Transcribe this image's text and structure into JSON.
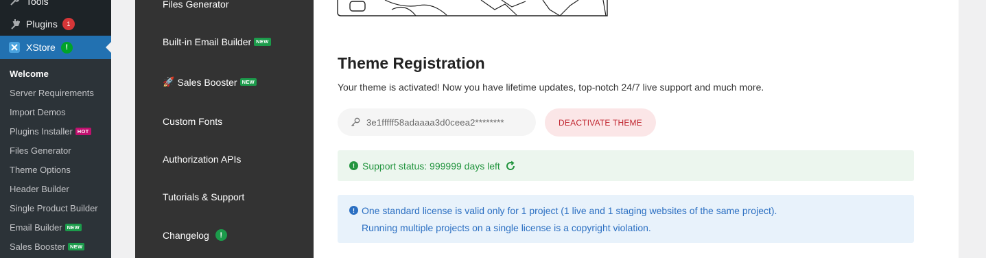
{
  "wp_menu": {
    "tools_label": "Tools",
    "plugins_label": "Plugins",
    "plugins_count": "1",
    "xstore_label": "XStore",
    "xstore_badge": "!"
  },
  "wp_submenu": {
    "items": [
      {
        "label": "Welcome"
      },
      {
        "label": "Server Requirements"
      },
      {
        "label": "Import Demos"
      },
      {
        "label": "Plugins Installer",
        "badge": "HOT"
      },
      {
        "label": "Files Generator"
      },
      {
        "label": "Theme Options"
      },
      {
        "label": "Header Builder"
      },
      {
        "label": "Single Product Builder"
      },
      {
        "label": "Email Builder",
        "badge": "NEW"
      },
      {
        "label": "Sales Booster",
        "badge": "NEW"
      }
    ]
  },
  "xstore_nav": {
    "items": [
      {
        "label": "Files Generator"
      },
      {
        "label": "Built-in Email Builder",
        "badge": "NEW"
      },
      {
        "label": "Sales Booster",
        "badge": "NEW",
        "emoji": "🚀"
      },
      {
        "label": "Custom Fonts"
      },
      {
        "label": "Authorization APIs"
      },
      {
        "label": "Tutorials & Support"
      },
      {
        "label": "Changelog",
        "badge": "!"
      }
    ]
  },
  "registration": {
    "title": "Theme Registration",
    "description": "Your theme is activated! Now you have lifetime updates, top-notch 24/7 live support and much more.",
    "license_key": "3e1fffff58adaaaa3d0ceea2********",
    "deactivate_label": "DEACTIVATE THEME",
    "support_status": "Support status: 999999 days left",
    "license_notice_line1": "One standard license is valid only for 1 project (1 live and 1 staging websites of the same project).",
    "license_notice_line2": "Running multiple projects on a single license is a copyright violation."
  },
  "colors": {
    "wp_sidebar": "#1d2327",
    "wp_submenu": "#2c3338",
    "wp_current": "#2271b1",
    "xstore_panel": "#333333",
    "success": "#23953f",
    "info": "#2b6fc2",
    "danger": "#c0252f"
  },
  "icons": {
    "tools": "wrench-icon",
    "plugins": "plugin-plug-icon",
    "xstore": "xstore-logo-icon",
    "key": "key-icon",
    "refresh": "refresh-icon",
    "support_status": "exclamation-circle-icon",
    "license_notice": "info-circle-icon"
  }
}
